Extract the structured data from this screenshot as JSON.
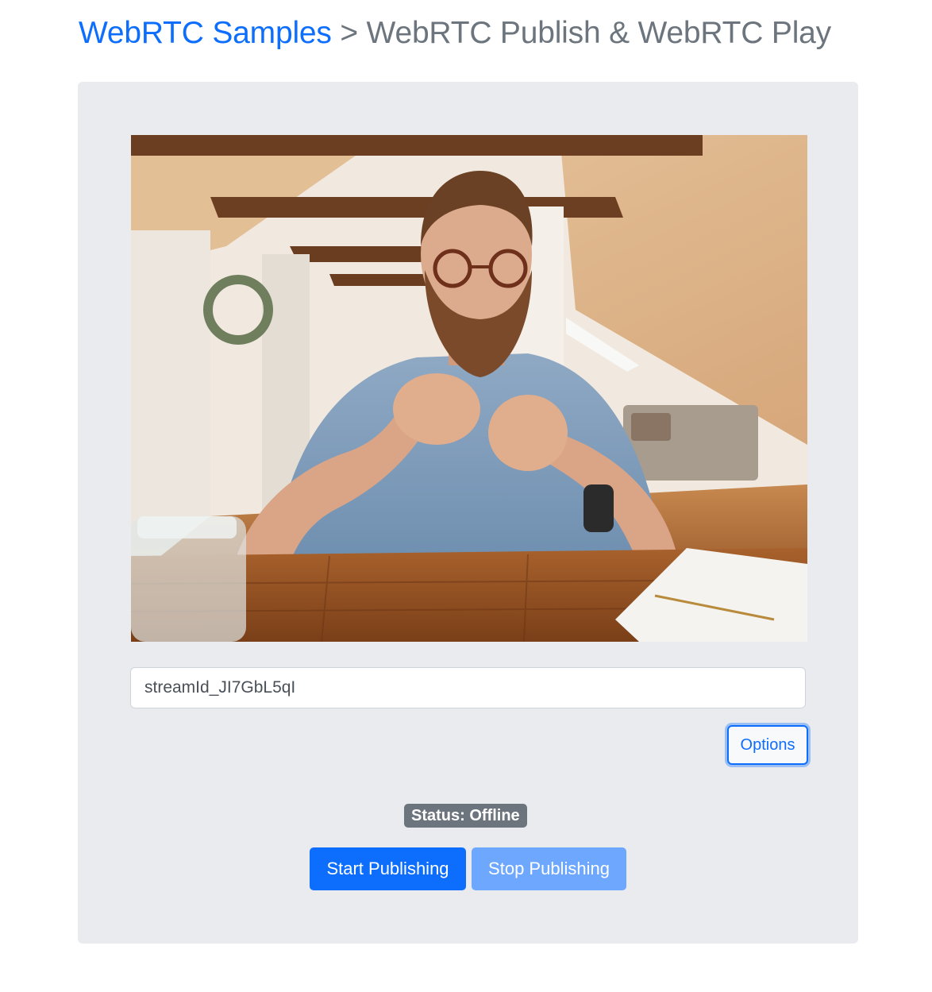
{
  "header": {
    "link_text": "WebRTC Samples",
    "rest_text": " > WebRTC Publish & WebRTC Play"
  },
  "video": {
    "description_icon": "camera-preview"
  },
  "stream_input": {
    "value": "streamId_JI7GbL5qI"
  },
  "options_button": {
    "label": "Options"
  },
  "status": {
    "label": "Status: Offline"
  },
  "actions": {
    "start_label": "Start Publishing",
    "stop_label": "Stop Publishing"
  },
  "colors": {
    "primary": "#0d6efd",
    "primary_disabled": "#6ea8fe",
    "badge": "#6c757d",
    "panel": "#e9ebef"
  }
}
